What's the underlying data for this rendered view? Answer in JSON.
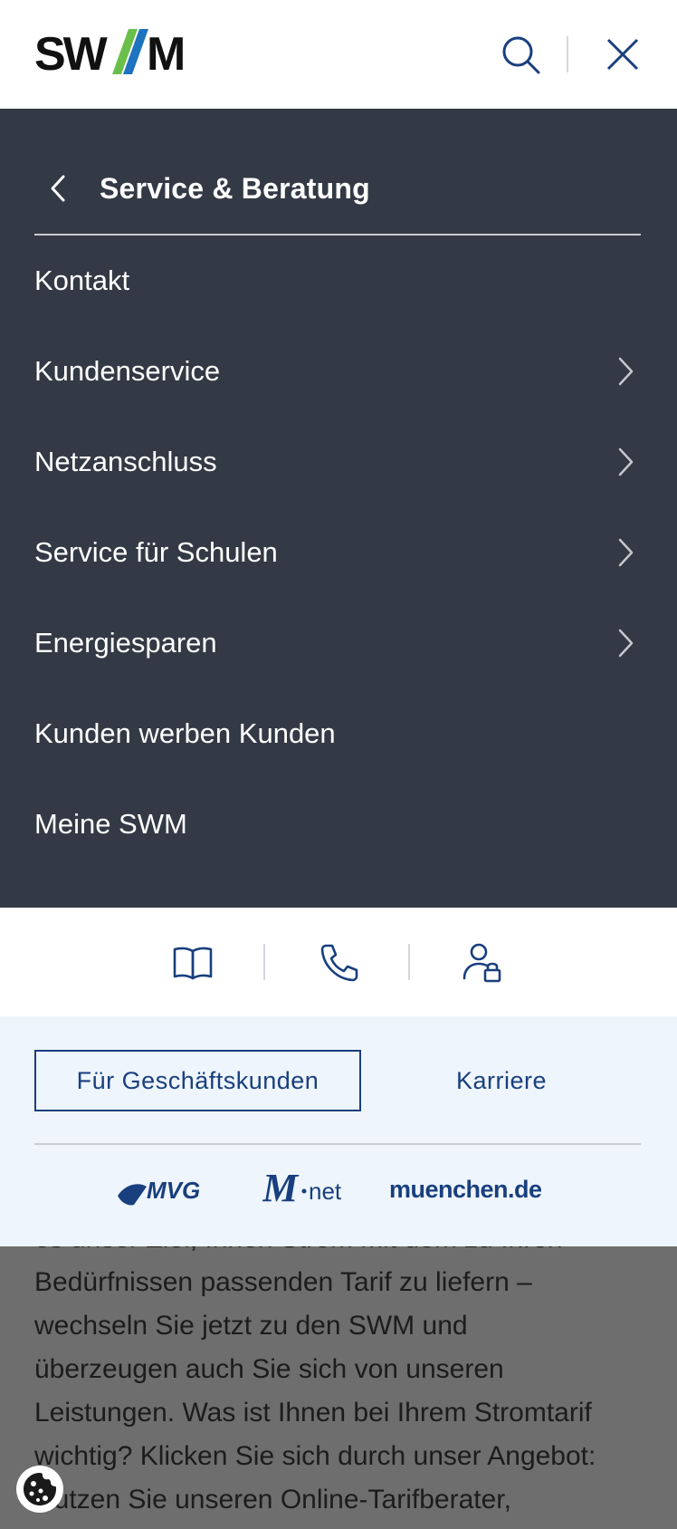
{
  "header": {
    "logo_text": "SWM",
    "logo_icon": "swm-logo",
    "search_icon": "search-icon",
    "close_icon": "close-icon"
  },
  "menu": {
    "back_icon": "chevron-left-icon",
    "title": "Service & Beratung",
    "items": [
      {
        "label": "Kontakt",
        "has_submenu": false
      },
      {
        "label": "Kundenservice",
        "has_submenu": true
      },
      {
        "label": "Netzanschluss",
        "has_submenu": true
      },
      {
        "label": "Service für Schulen",
        "has_submenu": true
      },
      {
        "label": "Energiesparen",
        "has_submenu": true
      },
      {
        "label": "Kunden werben Kunden",
        "has_submenu": false
      },
      {
        "label": "Meine SWM",
        "has_submenu": false
      }
    ]
  },
  "quickbar": {
    "icons": [
      "book-icon",
      "phone-icon",
      "user-lock-icon"
    ]
  },
  "footer": {
    "business_button": "Für Geschäftskunden",
    "career_link": "Karriere",
    "partners": [
      {
        "name": "MVG",
        "icon": "mvg-logo"
      },
      {
        "name": "M-net",
        "icon": "mnet-logo"
      },
      {
        "name": "muenchen.de",
        "icon": "muenchen-de-logo"
      }
    ]
  },
  "background": {
    "lines": [
      "es unser Ziel, Ihnen Strom mit dem zu Ihren",
      "Bedürfnissen passenden Tarif zu liefern –",
      "wechseln Sie jetzt zu den SWM und",
      "überzeugen auch Sie sich von unseren",
      "Leistungen. Was ist Ihnen bei Ihrem Stromtarif",
      "wichtig? Klicken Sie sich durch unser Angebot:",
      "Nutzen Sie unseren Online-Tarifberater,"
    ]
  },
  "cookie_icon": "cookie-icon",
  "colors": {
    "menu_bg": "#333a45",
    "brand_blue": "#193f7e",
    "footer_bg": "#eef5fc",
    "overlay": "#6e6e6e",
    "logo_green": "#6abf4b",
    "logo_blue": "#1e73be"
  }
}
